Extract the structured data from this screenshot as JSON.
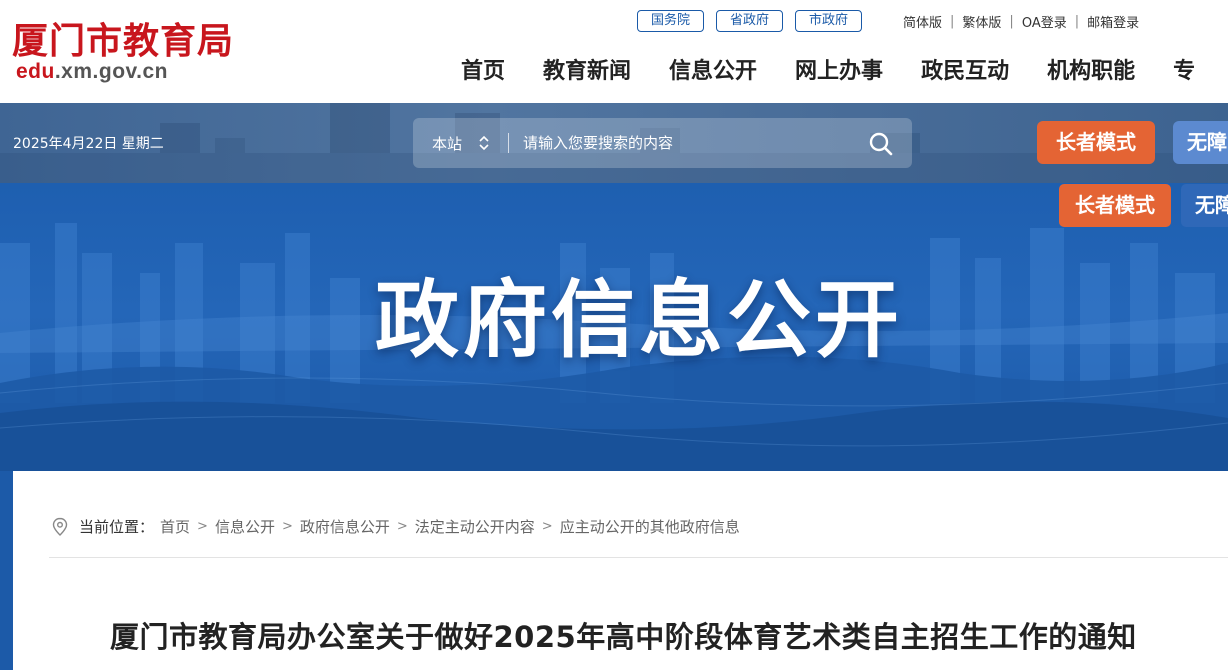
{
  "header": {
    "logo_title": "厦门市教育局",
    "logo_domain_prefix": "edu",
    "logo_domain_rest": ".xm.gov.cn",
    "gov_links": [
      "国务院",
      "省政府",
      "市政府"
    ],
    "utility_links": [
      "简体版",
      "繁体版",
      "OA登录",
      "邮箱登录"
    ],
    "nav": [
      "首页",
      "教育新闻",
      "信息公开",
      "网上办事",
      "政民互动",
      "机构职能",
      "专"
    ]
  },
  "search_bar": {
    "date": "2025年4月22日 星期二",
    "scope": "本站",
    "placeholder": "请输入您要搜索的内容",
    "elder_mode": "长者模式",
    "accessibility": "无障"
  },
  "banner": {
    "title": "政府信息公开",
    "elder_mode": "长者模式",
    "accessibility": "无障"
  },
  "breadcrumb": {
    "label": "当前位置：",
    "items": [
      "首页",
      "信息公开",
      "政府信息公开",
      "法定主动公开内容",
      "应主动公开的其他政府信息"
    ]
  },
  "article": {
    "title": "厦门市教育局办公室关于做好2025年高中阶段体育艺术类自主招生工作的通知"
  },
  "colors": {
    "brand_red": "#c8161d",
    "primary_blue": "#1a5aa8",
    "elder_orange": "#e46434"
  }
}
